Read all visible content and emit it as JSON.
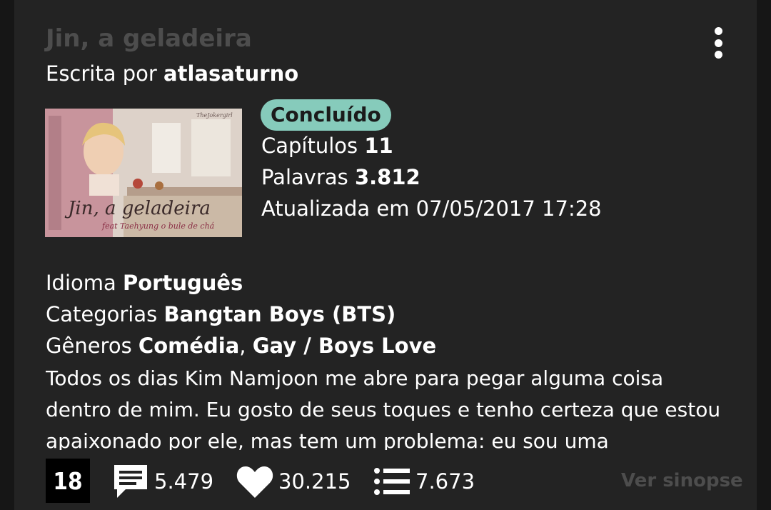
{
  "story": {
    "title": "Jin, a geladeira",
    "author_prefix": "Escrita por",
    "author": "atlasaturno",
    "status": "Concluído",
    "chapters_label": "Capítulos",
    "chapters": "11",
    "words_label": "Palavras",
    "words": "3.812",
    "updated_label": "Atualizada em",
    "updated": "07/05/2017 17:28",
    "cover_title": "Jin, a geladeira",
    "cover_subtitle": "feat Taehyung o bule de chá",
    "cover_signature": "TheJokergirl"
  },
  "info": {
    "language_label": "Idioma",
    "language": "Português",
    "categories_label": "Categorias",
    "categories": "Bangtan Boys (BTS)",
    "genres_label": "Gêneros",
    "genre_1": "Comédia",
    "genre_sep": ", ",
    "genre_2": "Gay / Boys Love"
  },
  "synopsis": "Todos os dias Kim Namjoon me abre para pegar alguma coisa dentro de mim. Eu gosto de seus toques e tenho certeza que estou apaixonado por ele, mas tem um problema: eu sou uma",
  "footer": {
    "age_rating": "18",
    "comments": "5.479",
    "favorites": "30.215",
    "lists": "7.673",
    "ver_sinopse": "Ver sinopse"
  },
  "colors": {
    "background": "#161616",
    "card": "#232323",
    "status_badge": "#86cbbb",
    "muted_text": "#4d4d4d"
  },
  "icons": {
    "more": "vertical-dots-icon",
    "comments": "comment-icon",
    "favorites": "heart-icon",
    "lists": "list-icon"
  }
}
